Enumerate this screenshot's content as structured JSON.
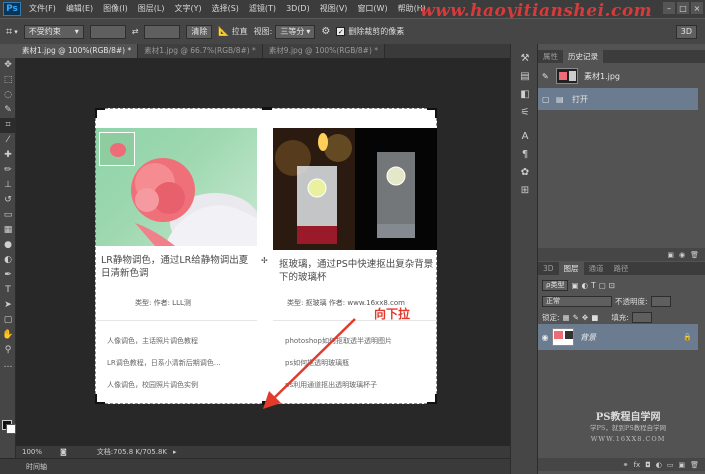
{
  "menubar": {
    "logo": "Ps",
    "items": [
      "文件(F)",
      "编辑(E)",
      "图像(I)",
      "图层(L)",
      "文字(Y)",
      "选择(S)",
      "滤镜(T)",
      "3D(D)",
      "视图(V)",
      "窗口(W)",
      "帮助(H)"
    ],
    "watermark": "www.haoyitianshei.com"
  },
  "options": {
    "ratio_value": "不受约束",
    "swap_symbol": "⇄",
    "clear_label": "清除",
    "straighten_label": "拉直",
    "view_label": "视图:",
    "view_value": "三等分",
    "delete_cropped_label": "删除裁剪的像素",
    "right_value": "3D"
  },
  "tabs": [
    {
      "label": "素材1.jpg @ 100%(RGB/8#) *",
      "active": true
    },
    {
      "label": "素材1.jpg @ 66.7%(RGB/8#) *",
      "active": false
    },
    {
      "label": "素材9.jpg @ 100%(RGB/8#) *",
      "active": false
    }
  ],
  "doc": {
    "card1": {
      "title": "LR静物调色，通过LR给静物调出夏日清新色调",
      "meta": "类型:   作者: LLL测",
      "list": [
        "人像调色，主话照片调色教程",
        "LR调色教程，日系小清新后期调色…",
        "人像调色，校园照片调色实例"
      ]
    },
    "card2": {
      "title": "抠玻璃，通过PS中快速抠出复杂背景下的玻璃杯",
      "meta": "类型: 抠玻璃   作者: www.16xx8.com",
      "list": [
        "photoshop如何抠取透半透明图片",
        "ps如何抠透明玻璃瓶",
        "ps利用通道抠出透明玻璃杯子"
      ]
    },
    "annotation": "向下拉"
  },
  "statusbar": {
    "zoom": "100%",
    "doc_info": "文档:705.8 K/705.8K"
  },
  "bottombar": {
    "label": "时间轴"
  },
  "history_panel": {
    "tabs": [
      {
        "label": "属性",
        "active": false
      },
      {
        "label": "历史记录",
        "active": true
      }
    ],
    "snapshot_label": "素材1.jpg",
    "items": [
      {
        "label": "打开",
        "selected": true
      }
    ]
  },
  "layers_panel": {
    "tabs": [
      {
        "label": "3D",
        "active": false
      },
      {
        "label": "图层",
        "active": true
      },
      {
        "label": "通道",
        "active": false
      },
      {
        "label": "路径",
        "active": false
      }
    ],
    "filter_label": "ρ类型",
    "blend_mode": "正常",
    "opacity_label": "不透明度:",
    "lock_label": "锁定:",
    "fill_label": "填充:",
    "layer_name": "背景",
    "lock_icon": "🔒"
  },
  "watermark2": {
    "title": "PS教程自学网",
    "sub": "学PS，就到PS教程自学网",
    "url": "WWW.16XX8.COM"
  }
}
